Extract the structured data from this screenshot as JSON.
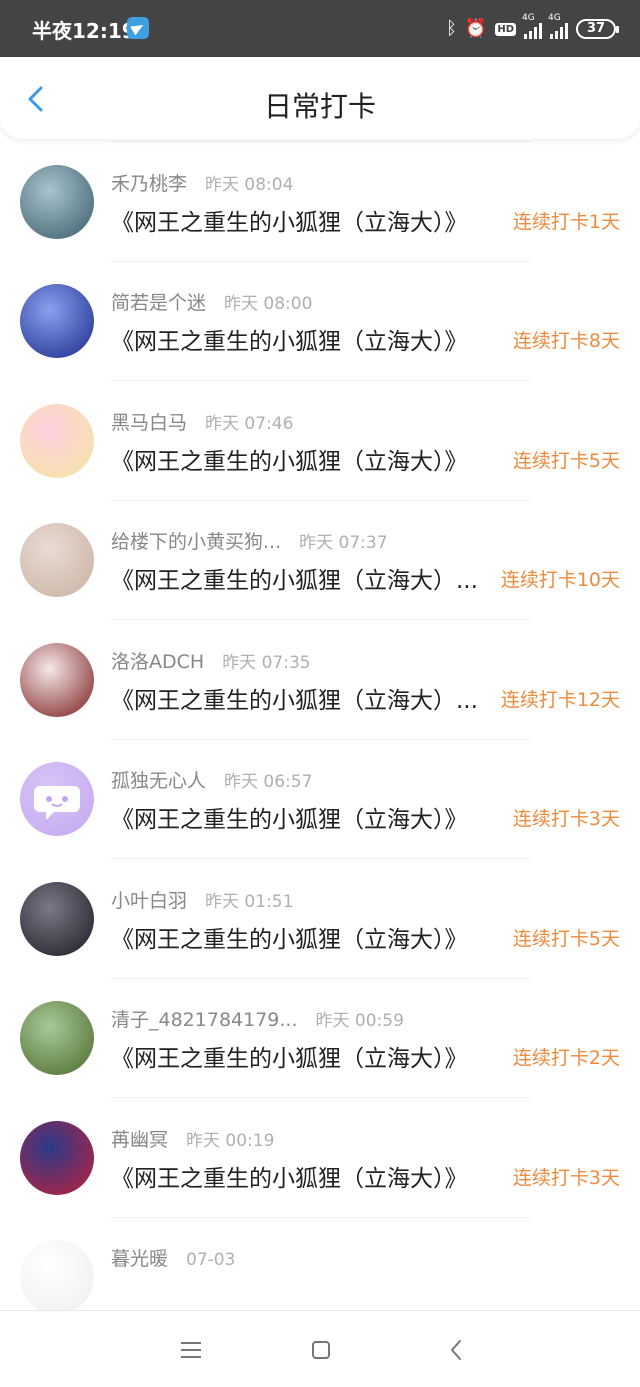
{
  "status_bar": {
    "time": "半夜12:19",
    "hd": "HD",
    "net1": "4G",
    "net2": "4G",
    "battery": "37"
  },
  "header": {
    "title": "日常打卡"
  },
  "colors": {
    "accent": "#3b9ae8",
    "streak": "#f08a3c"
  },
  "entries": [
    {
      "name": "",
      "time": "",
      "book": "《网王之重生的小狐狸（立海大）》",
      "streak": "连续打卡1天"
    },
    {
      "name": "禾乃桃李",
      "time": "昨天 08:04",
      "book": "《网王之重生的小狐狸（立海大）》",
      "streak": "连续打卡1天"
    },
    {
      "name": "简若是个迷",
      "time": "昨天 08:00",
      "book": "《网王之重生的小狐狸（立海大）》",
      "streak": "连续打卡8天"
    },
    {
      "name": "黑马白马",
      "time": "昨天 07:46",
      "book": "《网王之重生的小狐狸（立海大）》",
      "streak": "连续打卡5天"
    },
    {
      "name": "给楼下的小黄买狗...",
      "time": "昨天 07:37",
      "book": "《网王之重生的小狐狸（立海大）...",
      "streak": "连续打卡10天"
    },
    {
      "name": "洛洛ADCH",
      "time": "昨天 07:35",
      "book": "《网王之重生的小狐狸（立海大）...",
      "streak": "连续打卡12天"
    },
    {
      "name": "孤独无心人",
      "time": "昨天 06:57",
      "book": "《网王之重生的小狐狸（立海大）》",
      "streak": "连续打卡3天"
    },
    {
      "name": "小叶白羽",
      "time": "昨天 01:51",
      "book": "《网王之重生的小狐狸（立海大）》",
      "streak": "连续打卡5天"
    },
    {
      "name": "清子_4821784179...",
      "time": "昨天 00:59",
      "book": "《网王之重生的小狐狸（立海大）》",
      "streak": "连续打卡2天"
    },
    {
      "name": "苒幽冥",
      "time": "昨天 00:19",
      "book": "《网王之重生的小狐狸（立海大）》",
      "streak": "连续打卡3天"
    },
    {
      "name": "暮光暖",
      "time": "07-03",
      "book": "",
      "streak": ""
    }
  ]
}
